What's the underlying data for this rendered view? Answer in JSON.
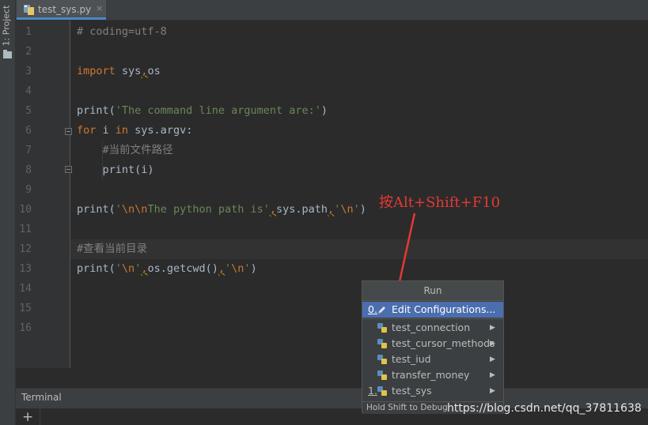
{
  "sidebar": {
    "label": "1: Project",
    "icon": "folder-icon"
  },
  "tab": {
    "filename": "test_sys.py",
    "close": "×",
    "icon": "python-file-icon"
  },
  "editor": {
    "line_numbers": [
      "1",
      "2",
      "3",
      "4",
      "5",
      "6",
      "7",
      "8",
      "9",
      "10",
      "11",
      "12",
      "13",
      "14",
      "15",
      "16"
    ],
    "code": {
      "l1": "# coding=utf-8",
      "l3_kw": "import",
      "l3_rest": " sys",
      "l3_sep": ",",
      "l3_tail": "os",
      "l5_fn": "print(",
      "l5_str": "'The command line argument are:'",
      "l5_end": ")",
      "l6_for": "for",
      "l6_i": " i ",
      "l6_in": "in",
      "l6_rest": " sys.argv:",
      "l7": "    #当前文件路径",
      "l8": "    print(i)",
      "l10_fn": "print(",
      "l10_q": "'",
      "l10_esc": "\\n\\n",
      "l10_str": "The python path is'",
      "l10_sep1": ",",
      "l10_mid": "sys.path",
      "l10_sep2": ",",
      "l10_str2a": "'",
      "l10_esc2": "\\n",
      "l10_str2b": "'",
      "l10_end": ")",
      "l12": "#查看当前目录",
      "l13_fn": "print(",
      "l13_qa": "'",
      "l13_esc": "\\n",
      "l13_qb": "'",
      "l13_sep1": ",",
      "l13_mid": "os.getcwd()",
      "l13_sep2": ",",
      "l13_q2a": "'",
      "l13_esc2": "\\n",
      "l13_q2b": "'",
      "l13_end": ")"
    }
  },
  "annotation": {
    "text": "按Alt+Shift+F10",
    "color": "#e53935"
  },
  "run_popup": {
    "title": "Run",
    "items": [
      {
        "mnemonic": "0.",
        "label": "Edit Configurations...",
        "selected": true,
        "icon": "edit-pencil-icon"
      },
      {
        "mnemonic": "",
        "label": "test_connection",
        "icon": "python-icon",
        "submenu": true
      },
      {
        "mnemonic": "",
        "label": "test_cursor_methods",
        "icon": "python-icon",
        "submenu": true
      },
      {
        "mnemonic": "",
        "label": "test_iud",
        "icon": "python-icon",
        "submenu": true
      },
      {
        "mnemonic": "",
        "label": "transfer_money",
        "icon": "python-icon",
        "submenu": true
      },
      {
        "mnemonic": "1.",
        "label": "test_sys",
        "icon": "python-icon",
        "submenu": true
      }
    ],
    "chevron": "▶",
    "footer": "Hold Shift to Debug"
  },
  "terminal": {
    "title": "Terminal",
    "add": "+"
  },
  "watermark": "https://blog.csdn.net/qq_37811638",
  "colors": {
    "editor_bg": "#2b2b2b",
    "keyword": "#cc7832",
    "string": "#6a8759",
    "comment": "#808080",
    "selection": "#4b6eaf"
  }
}
